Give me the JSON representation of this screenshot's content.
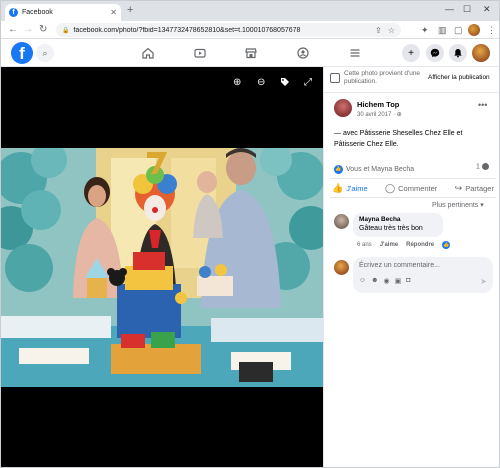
{
  "browser": {
    "tab_title": "Facebook",
    "tab_close": "✕",
    "new_tab": "+",
    "url": "facebook.com/photo/?fbid=1347732478652810&set=t.100010768057678",
    "controls": {
      "minimize": "—",
      "maximize": "☐",
      "close": "✕"
    },
    "icons": {
      "back": "back-arrow-icon",
      "forward": "forward-arrow-icon",
      "reload": "reload-icon",
      "lock": "lock-icon",
      "share": "share-icon",
      "star": "bookmark-star-icon"
    }
  },
  "fb": {
    "logo": "f",
    "nav": [
      "home-icon",
      "watch-icon",
      "marketplace-icon",
      "groups-icon",
      "menu-icon"
    ],
    "actions": [
      "create-icon",
      "messenger-icon",
      "notifications-icon"
    ]
  },
  "viewer": {
    "tools": [
      "zoom-in-icon",
      "zoom-out-icon",
      "tag-icon",
      "fullscreen-icon"
    ]
  },
  "panel": {
    "notice_text": "Cette photo provient d'une publication.",
    "notice_link": "Afficher la publication",
    "author": "Hichem Top",
    "date": "30 avril 2017 · ",
    "post_text": "— avec Pâtisserie Sheselles Chez Elle et Pâtisserie Chez Elle.",
    "reactions": "Vous et Mayna Becha",
    "comment_count": "1",
    "like_label": "J'aime",
    "comment_label": "Commenter",
    "share_label": "Partager",
    "sort_label": "Plus pertinents",
    "comment": {
      "name": "Mayna Becha",
      "text": "Gâteau très très bon",
      "age": "6 ans",
      "like": "J'aime",
      "reply": "Répondre"
    },
    "write_placeholder": "Écrivez un commentaire..."
  },
  "colors": {
    "fb_blue": "#1877f2",
    "secondary_text": "#65676b",
    "bubble": "#f0f2f5"
  }
}
